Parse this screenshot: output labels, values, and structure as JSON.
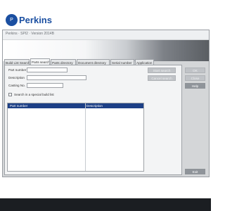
{
  "window": {
    "title": "Perkins · SPI2 · Version 2014B"
  },
  "brand": {
    "logo_word": "Perkins",
    "logo_badge": "P",
    "color": "#1b4fa1"
  },
  "tabs": [
    {
      "label": "Build List Search",
      "active": false
    },
    {
      "label": "Parts search",
      "active": true
    },
    {
      "label": "Parts directory",
      "active": false
    },
    {
      "label": "Document directory",
      "active": false
    },
    {
      "label": "Serial number",
      "active": false
    },
    {
      "label": "Application",
      "active": false
    }
  ],
  "form": {
    "part_number_label": "Part number",
    "part_number_value": "",
    "description_label": "Description",
    "description_value": "",
    "casting_label": "Casting No.",
    "casting_value": "",
    "special_build_list_label": "Search in a special build list",
    "special_build_list_checked": false
  },
  "actions": {
    "start_search": "Start search",
    "cancel_search": "Cancel search",
    "ok": "OK",
    "close": "Close",
    "help": "Help",
    "exit": "Exit"
  },
  "results": {
    "columns": [
      "Part number",
      "Description"
    ],
    "rows": []
  }
}
